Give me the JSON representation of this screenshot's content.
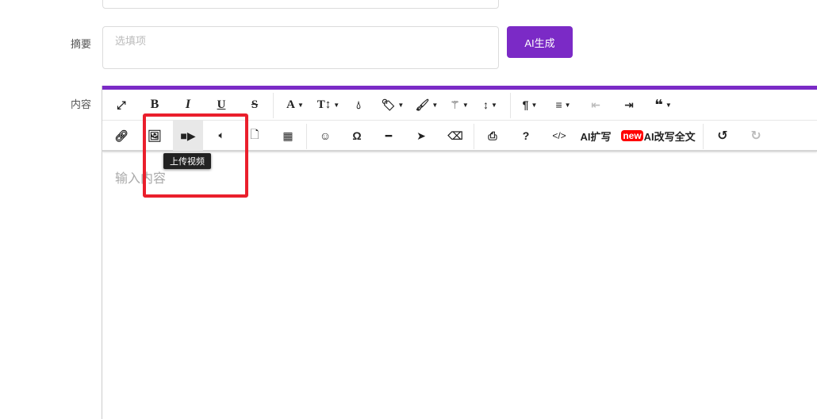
{
  "form": {
    "summary_label": "摘要",
    "summary_placeholder": "选填项",
    "ai_generate": "AI生成",
    "content_label": "内容"
  },
  "toolbar": {
    "ai_expand": "AI扩写",
    "new_badge": "new",
    "ai_rewrite": "AI改写全文",
    "tooltip": "上传视频"
  },
  "editor": {
    "placeholder": "输入内容"
  },
  "colors": {
    "accent": "#7b2ac6",
    "highlight": "#ea1f2c"
  }
}
